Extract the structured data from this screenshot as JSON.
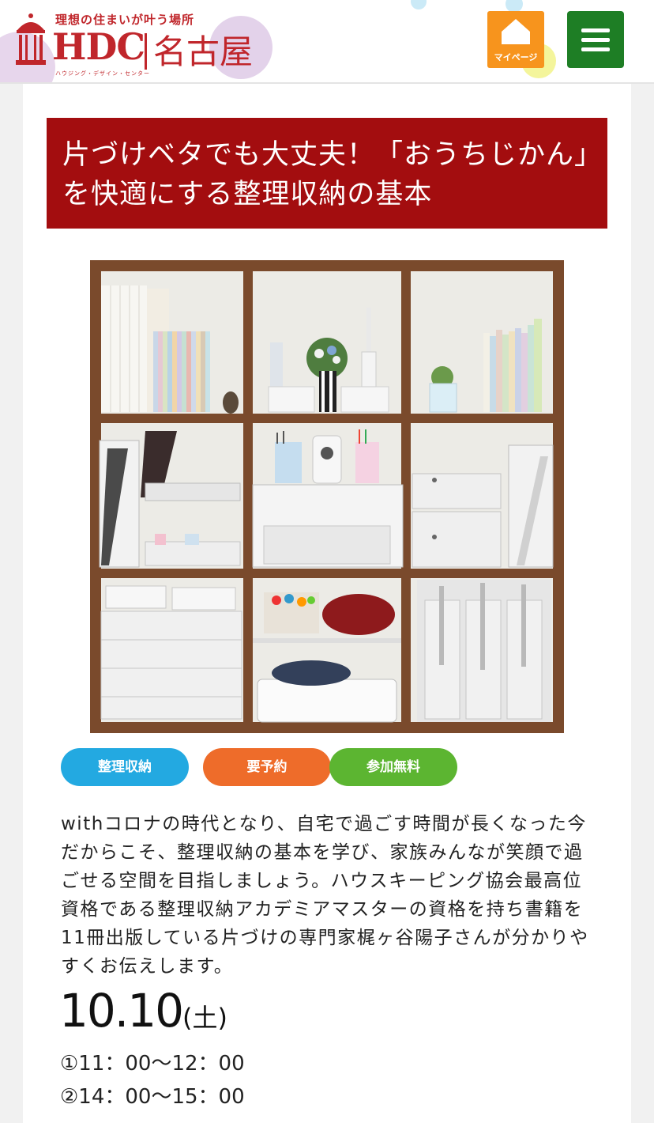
{
  "header": {
    "logo": {
      "tagline": "理想の住まいが叶う場所",
      "brand": "HDC",
      "city": "名古屋",
      "subtitle": "ハウジング・デザイン・センター"
    },
    "mypage_label": "マイページ",
    "icons": {
      "mypage": "home-icon",
      "menu": "hamburger-menu-icon"
    },
    "colors": {
      "mypage": "#f7941d",
      "menu": "#1e7e25",
      "logo": "#c0262b"
    }
  },
  "article": {
    "title": "片づけベタでも大丈夫！「おうちじかん」を快適にする整理収納の基本",
    "title_bg": "#a30d0f",
    "image_subject": "shelf-storage-photo",
    "tags": [
      {
        "label": "整理収納",
        "color": "#23a9e1"
      },
      {
        "label": "要予約",
        "color": "#ee6c2a"
      },
      {
        "label": "参加無料",
        "color": "#5cb531"
      }
    ],
    "description": "withコロナの時代となり、自宅で過ごす時間が長くなった今だからこそ、整理収納の基本を学び、家族みんなが笑顔で過ごせる空間を目指しましょう。ハウスキーピング協会最高位資格である整理収納アカデミアマスターの資格を持ち書籍を11冊出版している片づけの専門家梶ヶ谷陽子さんが分かりやすくお伝えします。",
    "date": {
      "main": "10.10",
      "day": "(土)"
    },
    "times": [
      "①11：00〜12：00",
      "②14：00〜15：00"
    ]
  }
}
